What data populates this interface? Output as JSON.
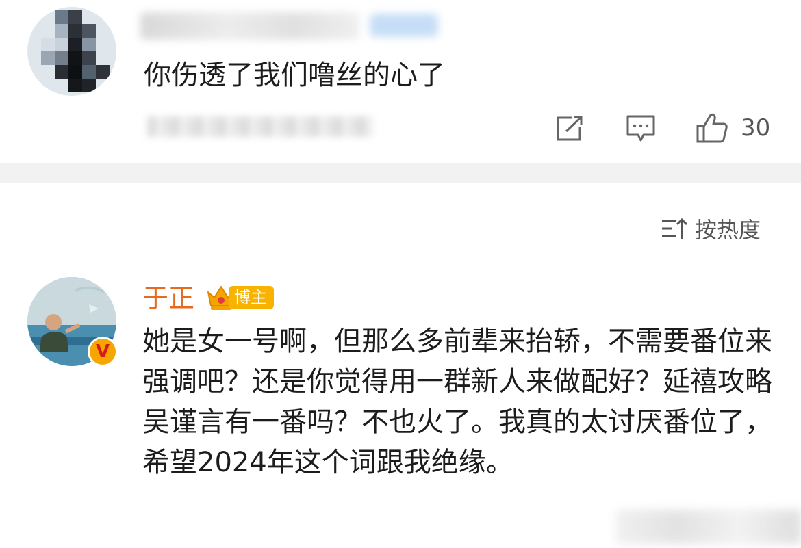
{
  "comment_top": {
    "text": "你伤透了我们噜丝的心了",
    "like_count": "30",
    "icons": {
      "share": "share-icon",
      "comment": "comment-icon",
      "like": "thumbs-up-icon"
    }
  },
  "sort": {
    "label": "按热度",
    "icon": "sort-icon"
  },
  "comment_main": {
    "username": "于正",
    "role_badge": "博主",
    "verified_badge": "V",
    "text": "她是女一号啊，但那么多前辈来抬轿，不需要番位来强调吧？还是你觉得用一群新人来做配好？延禧攻略吴谨言有一番吗？不也火了。我真的太讨厌番位了，希望2024年这个词跟我绝缘。"
  },
  "colors": {
    "username": "#e86a20",
    "badge": "#f8b200",
    "divider": "#f2f2f2",
    "icon_gray": "#666666"
  }
}
